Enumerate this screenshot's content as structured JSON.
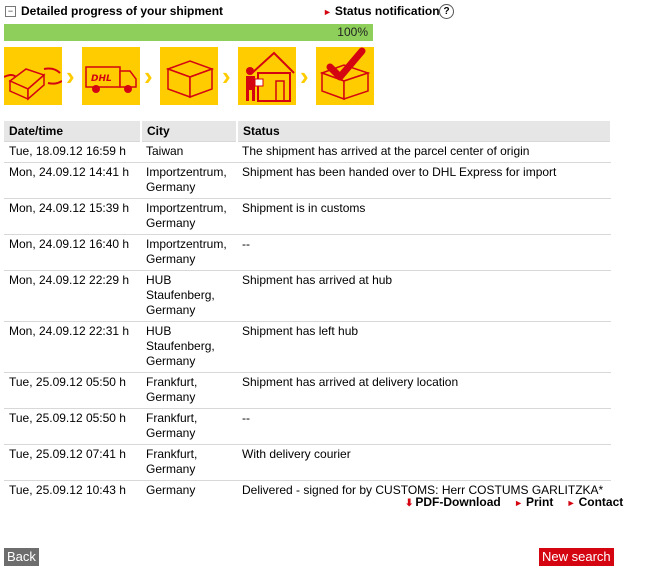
{
  "header": {
    "title": "Detailed progress of your shipment",
    "collapse_symbol": "−",
    "status_link": "Status notification",
    "help_symbol": "?"
  },
  "progress": {
    "label": "100%",
    "value": 100,
    "color": "#8dcf5a"
  },
  "steps": [
    {
      "icon": "parcel-handover-icon"
    },
    {
      "icon": "dhl-truck-icon"
    },
    {
      "icon": "parcel-box-icon"
    },
    {
      "icon": "courier-delivery-icon"
    },
    {
      "icon": "delivered-checkmark-icon"
    }
  ],
  "table": {
    "headers": [
      "Date/time",
      "City",
      "Status"
    ],
    "rows": [
      {
        "datetime": "Tue, 18.09.12 16:59 h",
        "city": "Taiwan",
        "status": "The shipment has arrived at the parcel center of origin"
      },
      {
        "datetime": "Mon, 24.09.12 14:41 h",
        "city": "Importzentrum, Germany",
        "status": "Shipment has been handed over to DHL Express for import"
      },
      {
        "datetime": "Mon, 24.09.12 15:39 h",
        "city": "Importzentrum, Germany",
        "status": "Shipment is in customs"
      },
      {
        "datetime": "Mon, 24.09.12 16:40 h",
        "city": "Importzentrum, Germany",
        "status": "--"
      },
      {
        "datetime": "Mon, 24.09.12 22:29 h",
        "city": "HUB Staufenberg, Germany",
        "status": "Shipment has arrived at hub"
      },
      {
        "datetime": "Mon, 24.09.12 22:31 h",
        "city": "HUB Staufenberg, Germany",
        "status": "Shipment has left hub"
      },
      {
        "datetime": "Tue, 25.09.12 05:50 h",
        "city": "Frankfurt, Germany",
        "status": "Shipment has arrived at delivery location"
      },
      {
        "datetime": "Tue, 25.09.12 05:50 h",
        "city": "Frankfurt, Germany",
        "status": "--"
      },
      {
        "datetime": "Tue, 25.09.12 07:41 h",
        "city": "Frankfurt, Germany",
        "status": "With delivery courier"
      },
      {
        "datetime": "Tue, 25.09.12 10:43 h",
        "city": "Germany",
        "status": "Delivered - signed for by CUSTOMS: Herr COSTUMS GARLITZKA*"
      }
    ]
  },
  "footer": {
    "pdf": "PDF-Download",
    "print": "Print",
    "contact": "Contact"
  },
  "buttons": {
    "back": "Back",
    "new_search": "New search"
  },
  "colors": {
    "accent": "#d40511",
    "step_bg": "#ffcc00",
    "progress": "#8dcf5a"
  }
}
